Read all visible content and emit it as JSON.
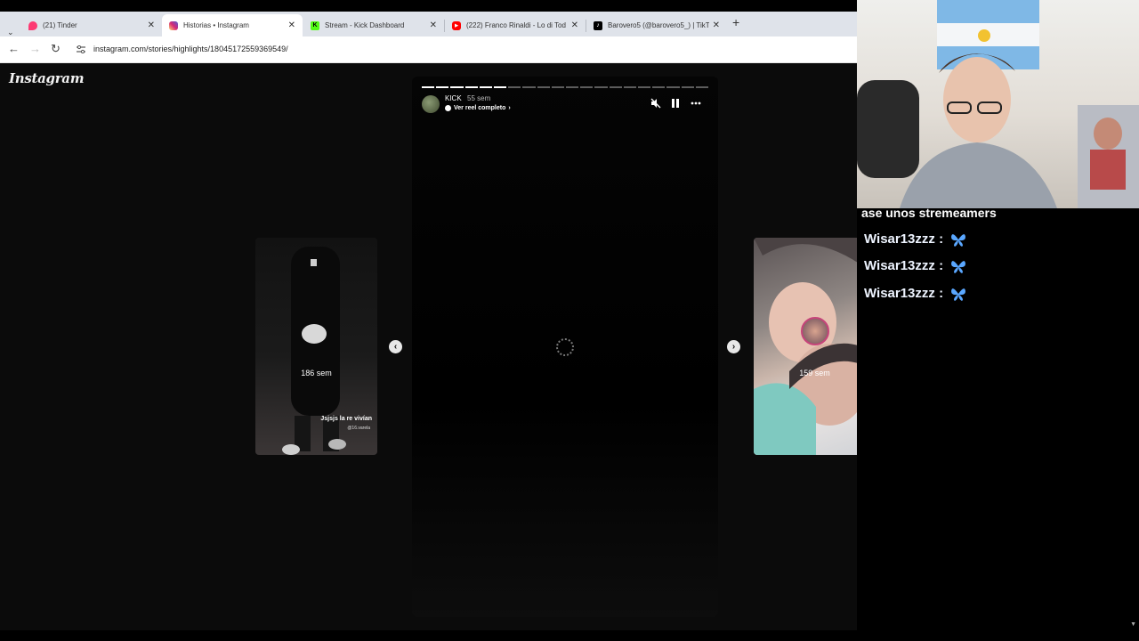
{
  "browser": {
    "tabs": [
      {
        "title": "(21) Tinder",
        "icon": "tinder-flame-icon",
        "color": "#fd3a73"
      },
      {
        "title": "Historias • Instagram",
        "icon": "instagram-icon",
        "color": "#d62976"
      },
      {
        "title": "Stream - Kick Dashboard",
        "icon": "kick-icon",
        "color": "#53fc18"
      },
      {
        "title": "(222) Franco Rinaldi - Lo di Tod",
        "icon": "youtube-icon",
        "color": "#ff0000"
      },
      {
        "title": "Barovero5 (@barovero5_) | TikT",
        "icon": "tiktok-icon",
        "color": "#000000"
      }
    ],
    "active_tab": 1,
    "new_tab": "+",
    "url": "instagram.com/stories/highlights/18045172559369549/"
  },
  "instagram": {
    "logo": "Instagram",
    "story": {
      "username": "KICK",
      "time": "55 sem",
      "reel_link": "Ver reel completo",
      "segments_total": 20,
      "segments_done": 6
    },
    "left_preview": {
      "time": "186 sem",
      "caption": "Jsjsjs la re vivían",
      "subcaption": "@16.varela"
    },
    "right_preview": {
      "time": "159 sem"
    }
  },
  "stream_overlay": {
    "banner": "ase unos stremeamers",
    "chat": [
      {
        "user": "Wisar13zzz :",
        "emoji": "blue-butterfly-icon"
      },
      {
        "user": "Wisar13zzz :",
        "emoji": "blue-butterfly-icon"
      },
      {
        "user": "Wisar13zzz :",
        "emoji": "blue-butterfly-icon"
      }
    ]
  },
  "colors": {
    "chrome_tabbar": "#dfe3ea",
    "page_bg": "#0b0b0b",
    "chat_text": "#eef4ff"
  }
}
